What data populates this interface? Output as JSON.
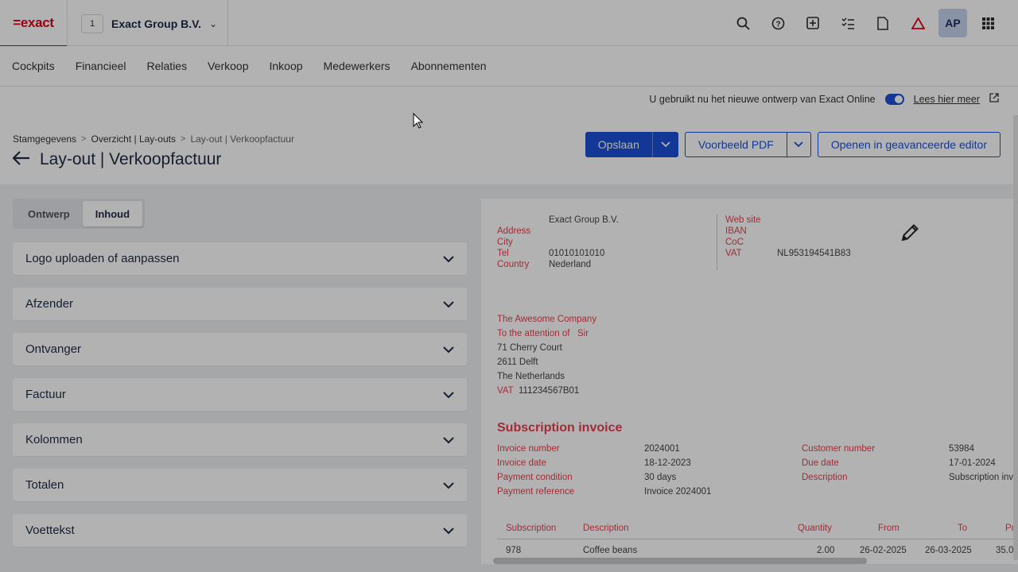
{
  "app": {
    "logo_text": "=exact",
    "brand_color": "#e0001a",
    "accent_color": "#1c4fd6"
  },
  "company": {
    "number": "1",
    "name": "Exact Group B.V."
  },
  "topbar_icons": [
    "search-icon",
    "help-icon",
    "add-icon",
    "tasks-icon",
    "document-icon",
    "alert-triangle-icon",
    "apps-grid-icon"
  ],
  "user": {
    "initials": "AP"
  },
  "nav": {
    "items": [
      "Cockpits",
      "Financieel",
      "Relaties",
      "Verkoop",
      "Inkoop",
      "Medewerkers",
      "Abonnementen"
    ]
  },
  "banner": {
    "text": "U gebruikt nu het nieuwe ontwerp van Exact Online",
    "toggle_on": true,
    "link": "Lees hier meer"
  },
  "breadcrumb": {
    "items": [
      "Stamgegevens",
      "Overzicht | Lay-outs"
    ],
    "current": "Lay-out | Verkoopfactuur"
  },
  "page": {
    "title": "Lay-out | Verkoopfactuur"
  },
  "actions": {
    "save": "Opslaan",
    "preview_pdf": "Voorbeeld PDF",
    "advanced_editor": "Openen in geavanceerde editor"
  },
  "tabs": {
    "design": "Ontwerp",
    "content": "Inhoud",
    "active": "content"
  },
  "sections": [
    "Logo uploaden of aanpassen",
    "Afzender",
    "Ontvanger",
    "Factuur",
    "Kolommen",
    "Totalen",
    "Voettekst"
  ],
  "invoice": {
    "sender_name": "Exact Group B.V.",
    "sender_labels": [
      "Address",
      "City",
      "Tel",
      "Country"
    ],
    "sender_tel": "01010101010",
    "sender_country": "Nederland",
    "sender_right_labels": [
      "Web site",
      "IBAN",
      "CoC",
      "VAT"
    ],
    "sender_vat": "NL953194541B83",
    "recipient": {
      "company": "The Awesome Company",
      "attention": "To the attention of",
      "attention_name": "Sir",
      "street": "71 Cherry Court",
      "city": "2611 Delft",
      "country": "The Netherlands",
      "vat_label": "VAT",
      "vat": "111234567B01"
    },
    "title": "Subscription invoice",
    "fields_left": [
      {
        "label": "Invoice number",
        "value": "2024001"
      },
      {
        "label": "Invoice date",
        "value": "18-12-2023"
      },
      {
        "label": "Payment condition",
        "value": "30 days"
      },
      {
        "label": "Payment reference",
        "value": "Invoice 2024001"
      }
    ],
    "fields_right": [
      {
        "label": "Customer number",
        "value": "53984"
      },
      {
        "label": "Due date",
        "value": "17-01-2024"
      },
      {
        "label": "Description",
        "value": "Subscription inv"
      }
    ],
    "table_headers": [
      "Subscription",
      "Description",
      "Quantity",
      "From",
      "To",
      "Pr"
    ],
    "table_row": [
      "978",
      "Coffee beans",
      "2.00",
      "26-02-2025",
      "26-03-2025",
      "35.0"
    ]
  }
}
